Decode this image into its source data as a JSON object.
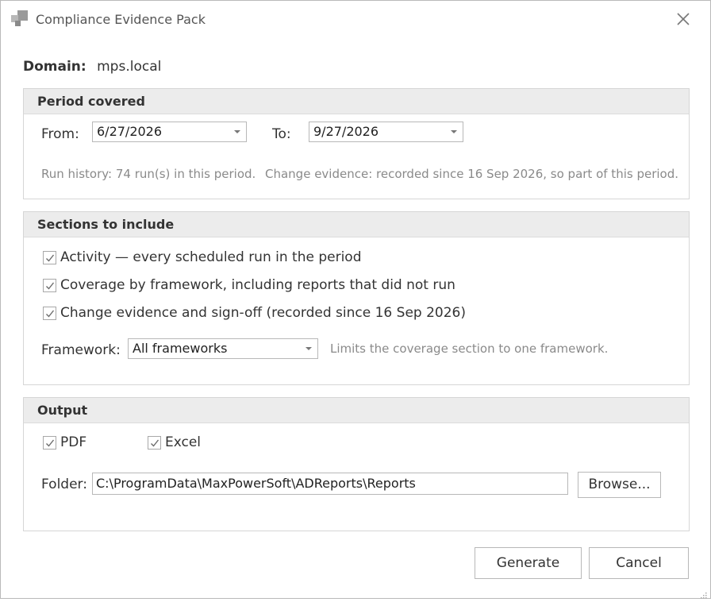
{
  "window": {
    "title": "Compliance Evidence Pack"
  },
  "domain": {
    "label": "Domain:",
    "value": "mps.local"
  },
  "period": {
    "header": "Period covered",
    "from_label": "From:",
    "from_value": "6/27/2026",
    "to_label": "To:",
    "to_value": "9/27/2026",
    "run_history": "Run history: 74 run(s) in this period.",
    "change_evidence": "Change evidence: recorded since 16 Sep 2026, so part of this period."
  },
  "sections": {
    "header": "Sections to include",
    "items": [
      {
        "label": "Activity — every scheduled run in the period",
        "checked": true
      },
      {
        "label": "Coverage by framework, including reports that did not run",
        "checked": true
      },
      {
        "label": "Change evidence and sign-off (recorded since 16 Sep 2026)",
        "checked": true
      }
    ],
    "framework_label": "Framework:",
    "framework_value": "All frameworks",
    "framework_hint": "Limits the coverage section to one framework."
  },
  "output": {
    "header": "Output",
    "pdf": {
      "label": "PDF",
      "checked": true
    },
    "excel": {
      "label": "Excel",
      "checked": true
    },
    "folder_label": "Folder:",
    "folder_value": "C:\\ProgramData\\MaxPowerSoft\\ADReports\\Reports",
    "browse_label": "Browse..."
  },
  "buttons": {
    "generate": "Generate",
    "cancel": "Cancel"
  },
  "colors": {
    "group_header_bg": "#ececec",
    "border": "#b8b8b8",
    "hint_text": "#8a8a8a",
    "check_mark": "#6a6a6a"
  }
}
